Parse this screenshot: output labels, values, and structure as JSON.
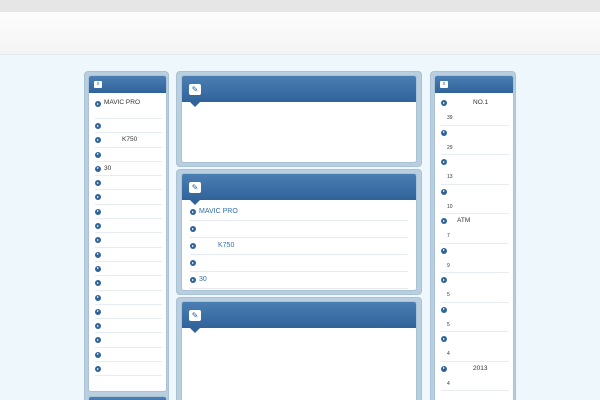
{
  "left_list": [
    "MAVIC PRO",
    "",
    "K750",
    "",
    "30",
    "",
    "",
    "",
    "",
    "",
    "",
    "",
    "",
    "",
    "",
    "",
    "",
    "",
    ""
  ],
  "center_list": [
    "MAVIC PRO",
    "",
    "K750",
    "",
    "30"
  ],
  "right_list": [
    {
      "title": "NO.1",
      "num": "39"
    },
    {
      "title": "",
      "num": "29"
    },
    {
      "title": "",
      "num": "13"
    },
    {
      "title": "",
      "num": "10"
    },
    {
      "title": "ATM",
      "num": "7"
    },
    {
      "title": "",
      "num": "9"
    },
    {
      "title": "",
      "num": "5"
    },
    {
      "title": "",
      "num": "5"
    },
    {
      "title": "",
      "num": "4"
    },
    {
      "title": "2013",
      "num": "4"
    }
  ],
  "icons": {
    "panel_toggle": "x",
    "edit": "✎"
  },
  "colors": {
    "header_blue": "#2f6399",
    "link_blue": "#2f6fb0",
    "frame": "#b9cfe0"
  }
}
